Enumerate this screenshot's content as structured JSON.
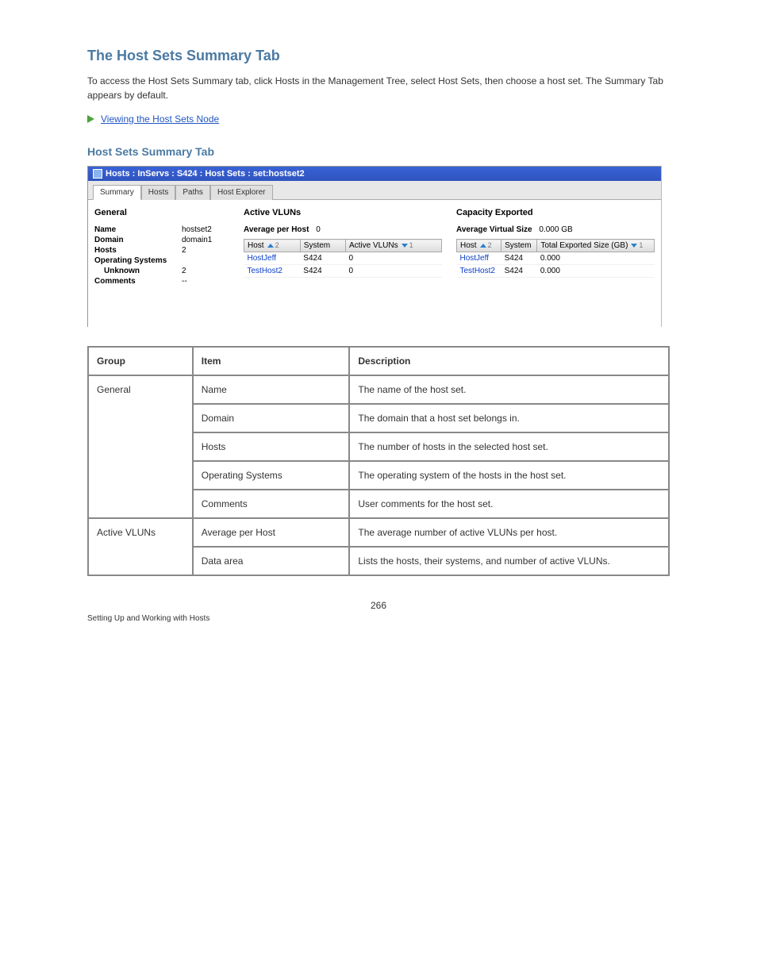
{
  "section_title": "The Host Sets Summary Tab",
  "intro_para": "To access the Host Sets Summary tab, click Hosts in the Management Tree, select Host Sets, then choose a host set. The Summary Tab appears by default.",
  "related_link_text": "Viewing the Host Sets Node",
  "figure_title": "Host Sets Summary Tab",
  "window": {
    "title": "Hosts : InServs : S424 : Host Sets : set:hostset2",
    "tabs": [
      "Summary",
      "Hosts",
      "Paths",
      "Host Explorer"
    ],
    "general": {
      "header": "General",
      "name_label": "Name",
      "name_value": "hostset2",
      "domain_label": "Domain",
      "domain_value": "domain1",
      "hosts_label": "Hosts",
      "hosts_value": "2",
      "os_label": "Operating Systems",
      "os_value": "",
      "unknown_label": "Unknown",
      "unknown_value": "2",
      "comments_label": "Comments",
      "comments_value": "--"
    },
    "vluns": {
      "header": "Active VLUNs",
      "avg_label": "Average per Host",
      "avg_value": "0",
      "cols": {
        "host": "Host",
        "system": "System",
        "active": "Active VLUNs"
      },
      "rows": [
        {
          "host": "HostJeff",
          "system": "S424",
          "active": "0"
        },
        {
          "host": "TestHost2",
          "system": "S424",
          "active": "0"
        }
      ]
    },
    "capacity": {
      "header": "Capacity Exported",
      "avg_label": "Average Virtual Size",
      "avg_value": "0.000 GB",
      "cols": {
        "host": "Host",
        "system": "System",
        "total": "Total Exported Size (GB)"
      },
      "rows": [
        {
          "host": "HostJeff",
          "system": "S424",
          "total": "0.000"
        },
        {
          "host": "TestHost2",
          "system": "S424",
          "total": "0.000"
        }
      ]
    }
  },
  "defs_header": {
    "group": "Group",
    "item": "Item",
    "description": "Description"
  },
  "defs": [
    {
      "group": "General",
      "item": "Name",
      "description": "The name of the host set."
    },
    {
      "group": "",
      "item": "Domain",
      "description": "The domain that a host set belongs in."
    },
    {
      "group": "",
      "item": "Hosts",
      "description": "The number of hosts in the selected host set."
    },
    {
      "group": "",
      "item": "Operating Systems",
      "description": "The operating system of the hosts in the host set."
    },
    {
      "group": "",
      "item": "Comments",
      "description": "User comments for the host set."
    },
    {
      "group": "Active VLUNs",
      "item": "Average per Host",
      "description": "The average number of active VLUNs per host."
    },
    {
      "group": "",
      "item": "Data area",
      "description": "Lists the hosts, their systems, and number of active VLUNs."
    }
  ],
  "page_number": "266",
  "footer": "Setting Up and Working with Hosts"
}
